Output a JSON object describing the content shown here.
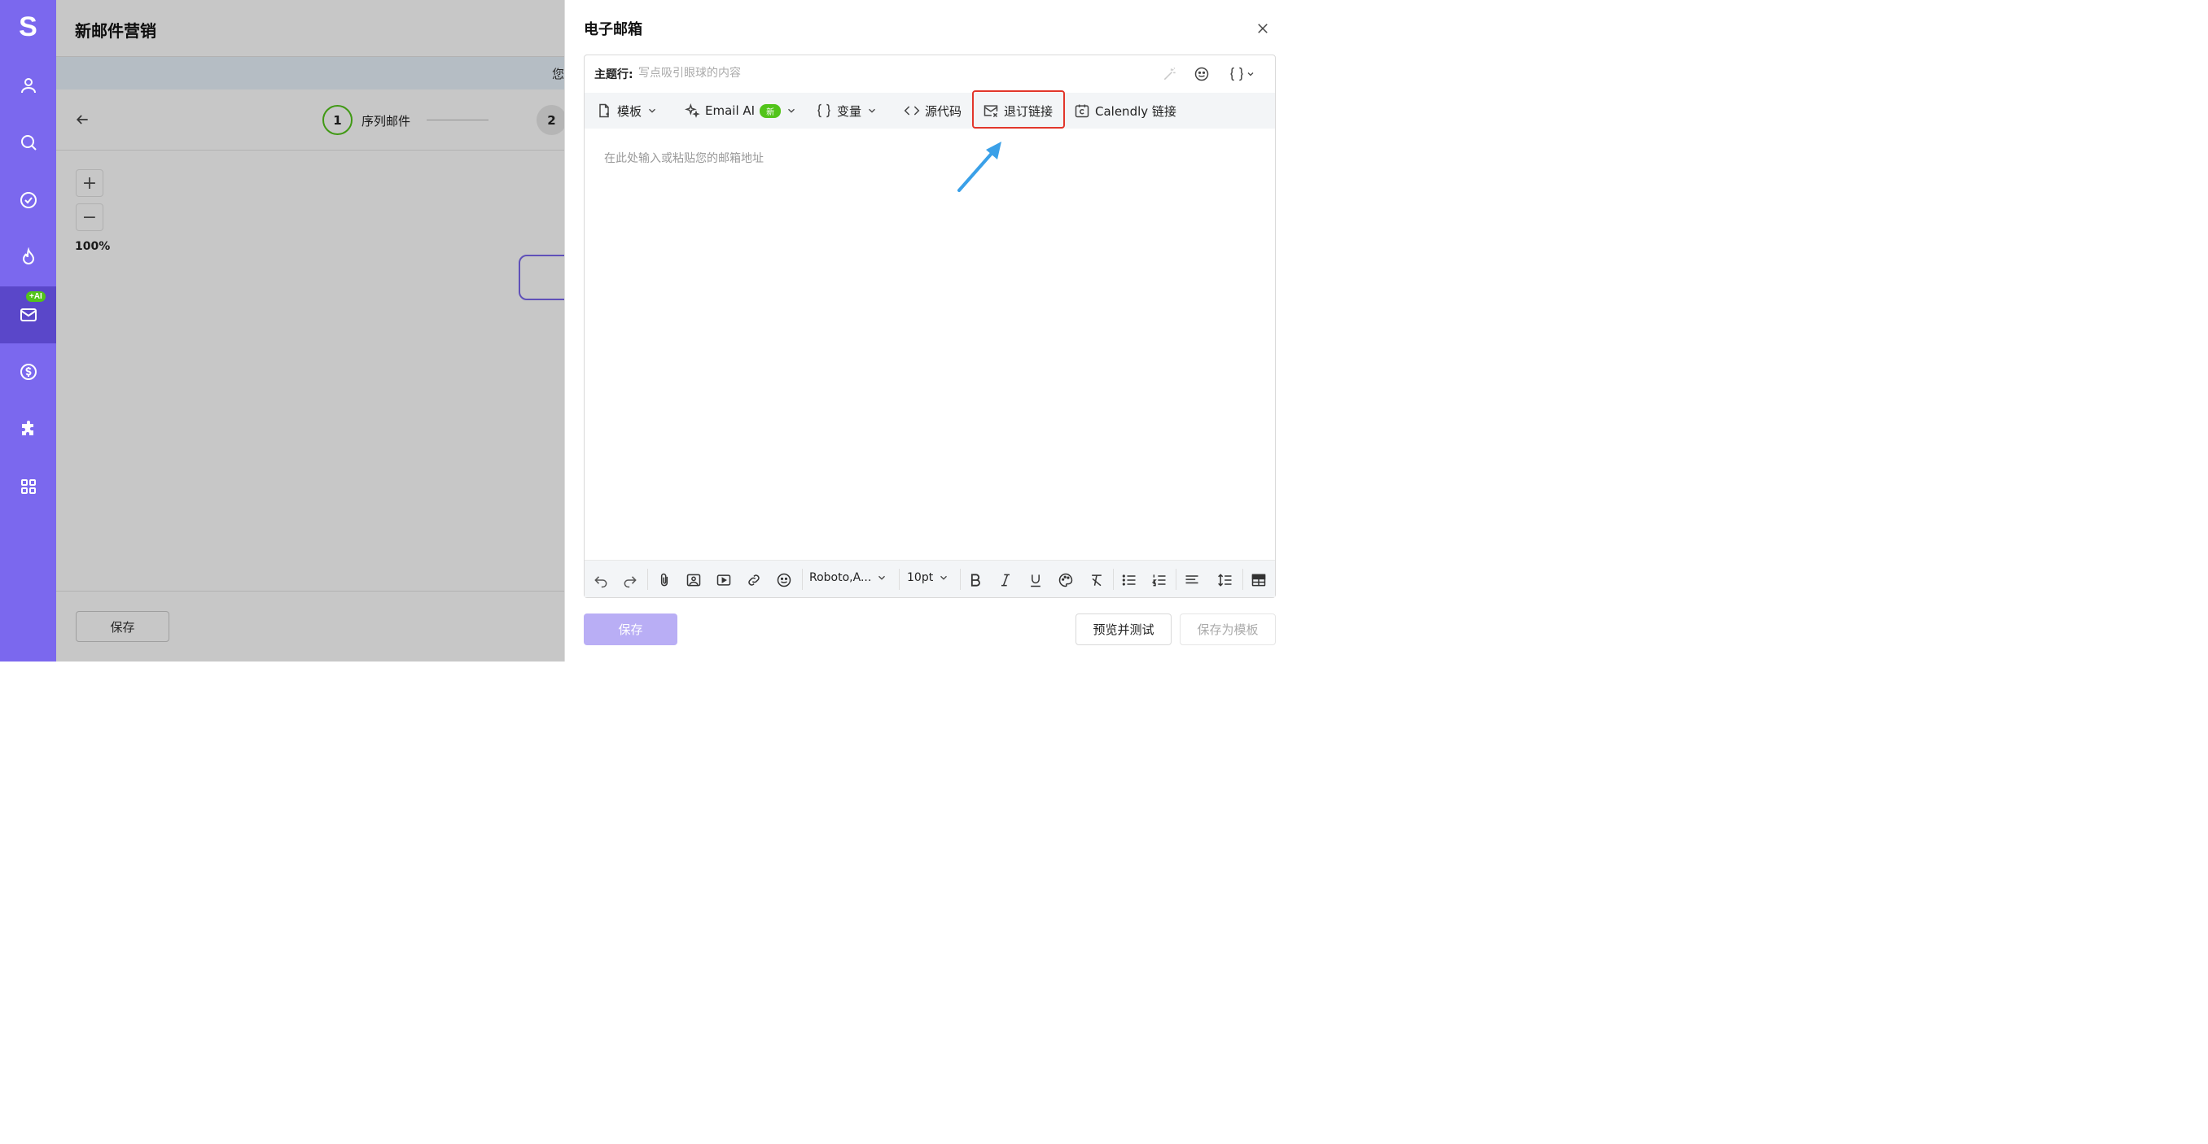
{
  "app": {
    "logo": "S"
  },
  "rail": {
    "ai_badge": "+AI",
    "items": [
      "user-icon",
      "search-icon",
      "check-circle-icon",
      "fire-icon",
      "mail-icon",
      "dollar-icon",
      "puzzle-icon",
      "apps-grid-icon"
    ]
  },
  "workspace": {
    "title": "新邮件营销",
    "notice_text": "您",
    "step1_number": "1",
    "step1_label": "序列邮件",
    "step2_number": "2",
    "zoom_in": "+",
    "zoom_out": "−",
    "zoom_level": "100%",
    "save_label": "保存"
  },
  "drawer": {
    "title": "电子邮箱",
    "subject_label": "主题行:",
    "subject_placeholder": "写点吸引眼球的内容",
    "toolbar": {
      "template": "模板",
      "email_ai": "Email AI",
      "new_badge": "新",
      "variables": "变量",
      "source_code": "源代码",
      "unsubscribe": "退订链接",
      "calendly": "Calendly 链接"
    },
    "body_placeholder": "在此处输入或粘贴您的邮箱地址",
    "format": {
      "font": "Roboto,A...",
      "size": "10pt"
    },
    "buttons": {
      "save": "保存",
      "preview": "预览并测试",
      "save_template": "保存为模板"
    }
  },
  "colors": {
    "brand": "#7b68ee",
    "highlight": "#e2362b",
    "arrow": "#3aa0e8",
    "badge": "#52c41a"
  }
}
